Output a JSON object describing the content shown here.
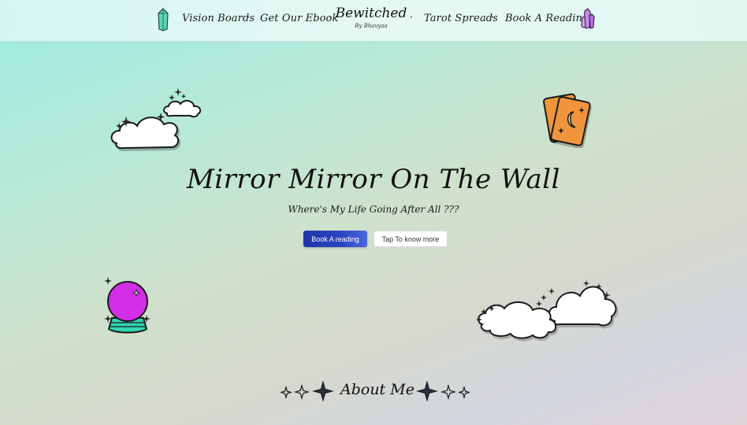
{
  "nav": {
    "links": [
      {
        "label": "Vision Boards"
      },
      {
        "label": "Get Our Ebook"
      },
      {
        "label": "Tarot Spreads"
      },
      {
        "label": "Book A Reading"
      }
    ],
    "separator": "·",
    "brand": {
      "title": "Bewitched",
      "subtitle": "By Bhavyaa"
    },
    "icons": [
      "green-crystal-icon",
      "purple-crystal-icon"
    ]
  },
  "hero": {
    "title": "Mirror Mirror On The Wall",
    "subtitle": "Where's My Life Going After All ???",
    "primary_button": "Book A reading",
    "secondary_button": "Tap To know more"
  },
  "decorations": [
    "cloud-icon",
    "tarot-cards-icon",
    "crystal-ball-icon",
    "sparkle-icon"
  ],
  "about": {
    "title": "About Me"
  },
  "colors": {
    "primary_button": "#2b46c2",
    "tarot_card": "#f0953c",
    "crystal_ball": "#d22ee6",
    "crystal_ball_base": "#2fd6b0",
    "crystal_green": "#5fd8b4",
    "crystal_purple": "#c58ae6"
  }
}
